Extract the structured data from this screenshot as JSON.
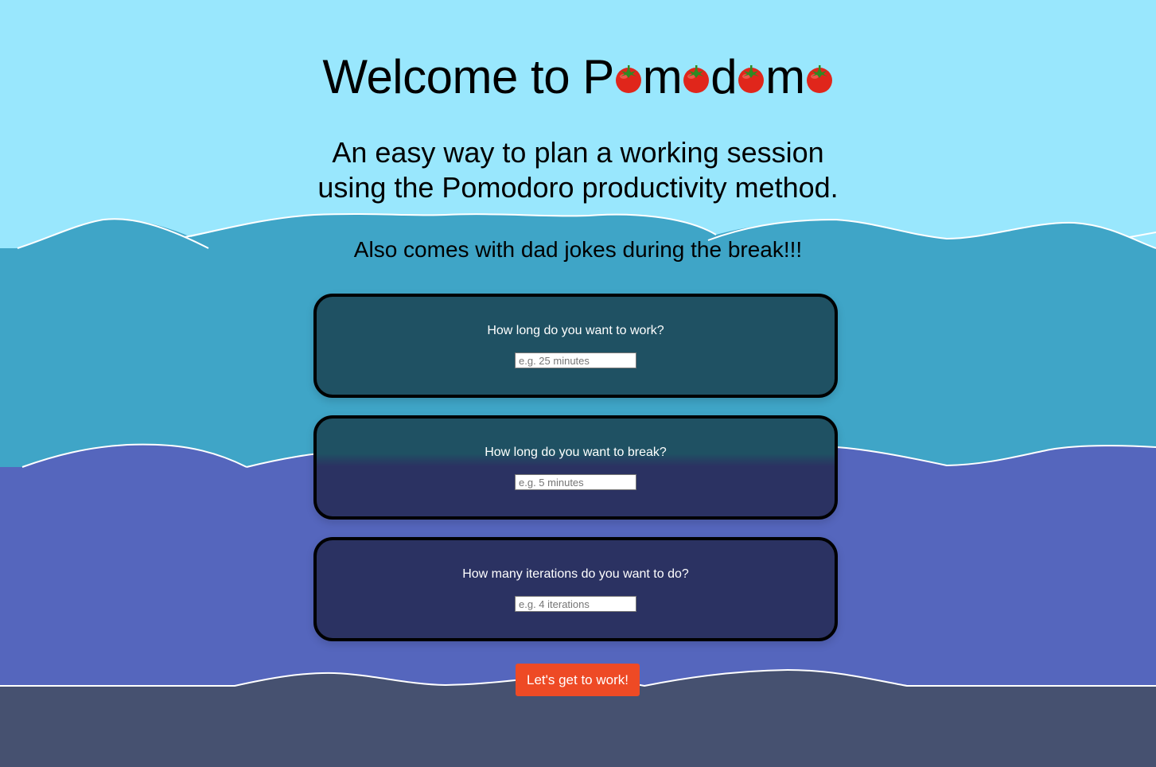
{
  "title": {
    "prefix": "Welcome to P",
    "letters": [
      "m",
      "d",
      "m"
    ],
    "tomato_icon": "tomato-emoji"
  },
  "subtitle": {
    "line1": "An easy way to plan a working session",
    "line2": "using the Pomodoro productivity method."
  },
  "tagline": "Also comes with dad jokes during the break!!!",
  "cards": [
    {
      "question": "How long do you want to work?",
      "placeholder": "e.g. 25 minutes"
    },
    {
      "question": "How long do you want to break?",
      "placeholder": "e.g. 5 minutes"
    },
    {
      "question": "How many iterations do you want to do?",
      "placeholder": "e.g. 4 iterations"
    }
  ],
  "start_button": {
    "label": "Let's get to work!"
  },
  "colors": {
    "sky": "#99e7fd",
    "wave_teal": "#3fa5c7",
    "wave_indigo": "#5566bd",
    "wave_slate": "#465170",
    "card_teal": "#1f5163",
    "card_indigo": "#2b3262",
    "button": "#ee4a25"
  }
}
